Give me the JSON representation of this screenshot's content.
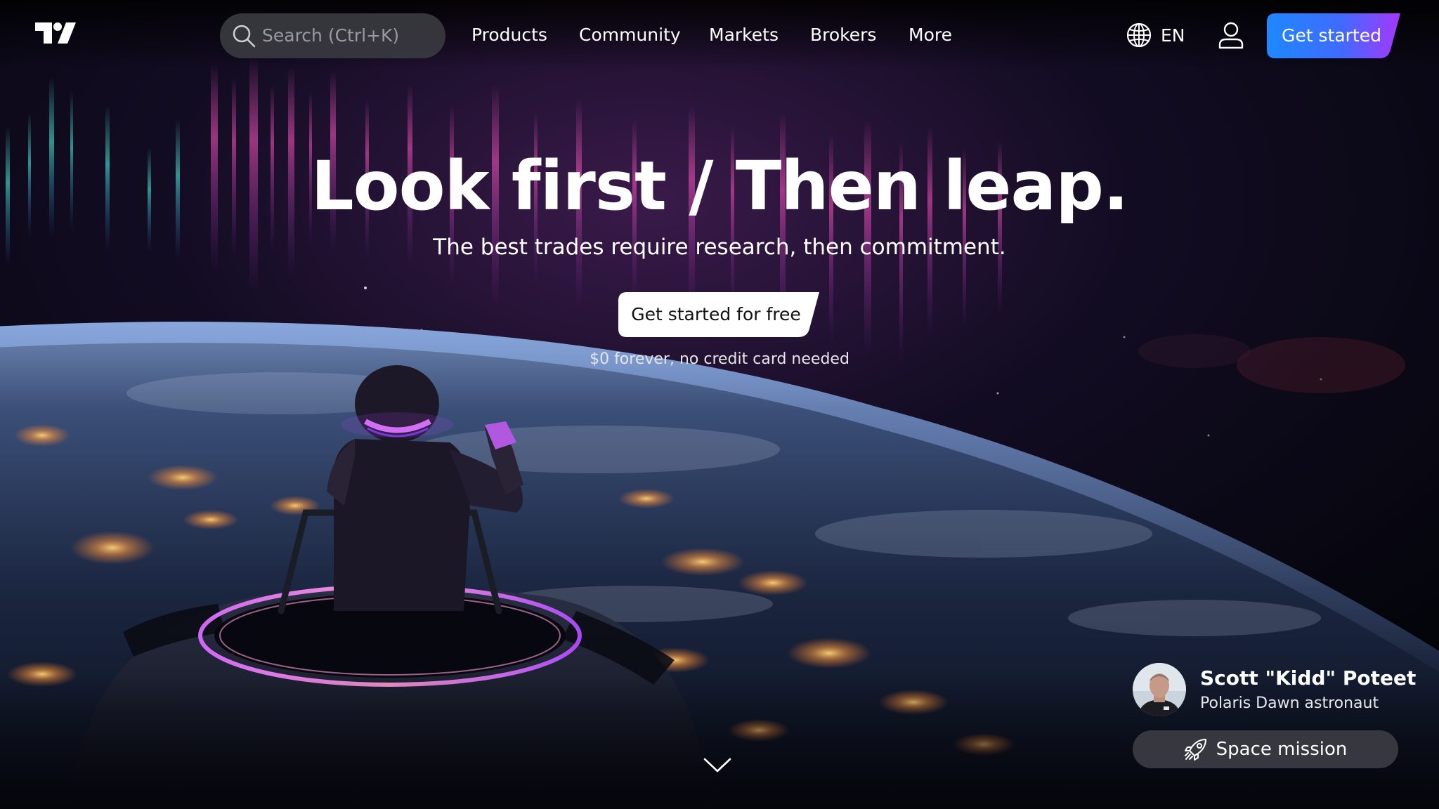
{
  "header": {
    "logo": "tradingview-logo",
    "search": {
      "placeholder": "Search (Ctrl+K)",
      "icon": "search-icon"
    },
    "nav": [
      {
        "label": "Products"
      },
      {
        "label": "Community"
      },
      {
        "label": "Markets"
      },
      {
        "label": "Brokers"
      },
      {
        "label": "More"
      }
    ],
    "language": {
      "icon": "globe-icon",
      "label": "EN"
    },
    "user_icon": "user-icon",
    "cta_label": "Get started"
  },
  "hero": {
    "title": "Look first / Then leap.",
    "subtitle": "The best trades require research, then commitment.",
    "cta_label": "Get started for free",
    "note": "$0 forever, no credit card needed",
    "scroll_icon": "chevron-down-icon"
  },
  "astronaut": {
    "name": "Scott \"Kidd\" Poteet",
    "role": "Polaris Dawn astronaut",
    "mission_label": "Space mission",
    "mission_icon": "rocket-icon"
  },
  "colors": {
    "cta_gradient_start": "#1e88ff",
    "cta_gradient_end": "#a637ff",
    "background": "#05060c",
    "aurora_pink": "#c23b98",
    "aurora_teal": "#3fd0c6",
    "city_lights": "#ffb050"
  }
}
